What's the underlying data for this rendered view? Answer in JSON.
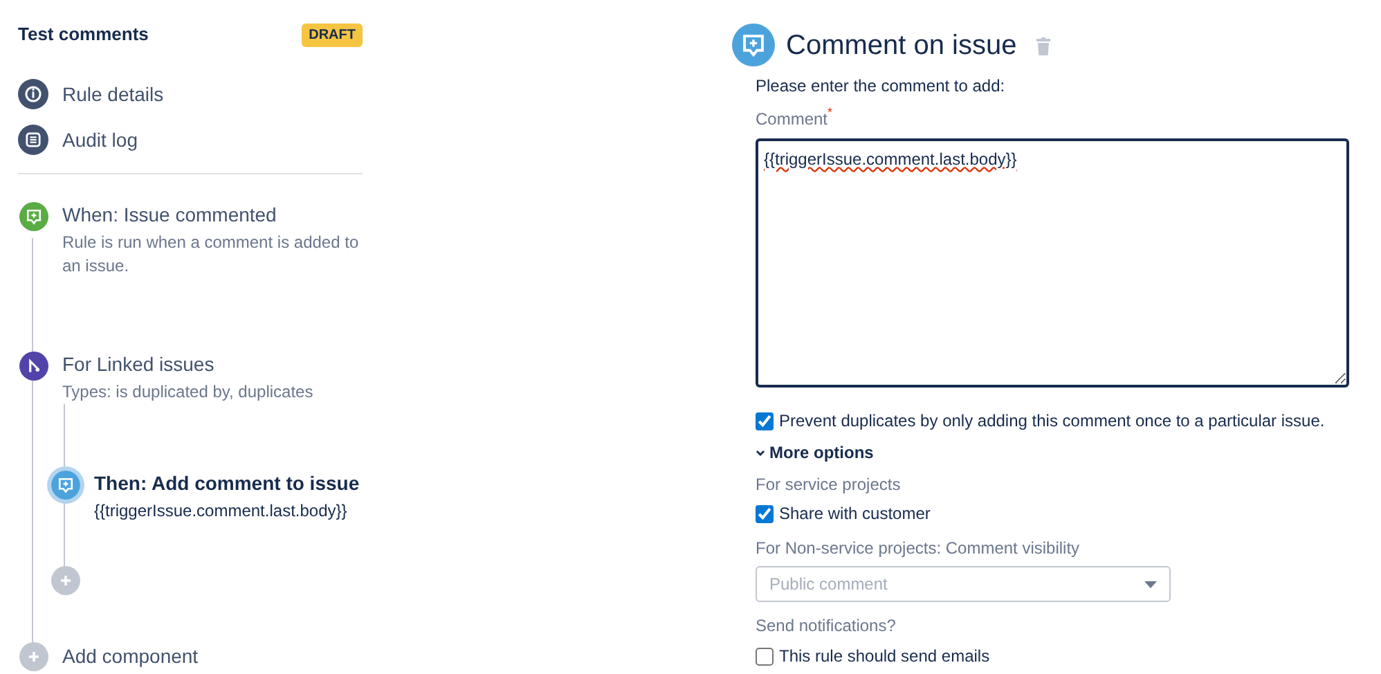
{
  "rule": {
    "title": "Test comments",
    "badge": "DRAFT"
  },
  "nav": [
    {
      "kind": "info",
      "label": "Rule details"
    },
    {
      "kind": "log",
      "label": "Audit log"
    }
  ],
  "components": [
    {
      "kind": "trigger",
      "title": "When: Issue commented",
      "description": "Rule is run when a comment is added to an issue.",
      "selected": false
    },
    {
      "kind": "branch",
      "title": "For Linked issues",
      "description": "Types: is duplicated by, duplicates",
      "selected": false,
      "children": [
        {
          "kind": "action",
          "title": "Then: Add comment to issue",
          "description": "{{triggerIssue.comment.last.body}}",
          "selected": true
        }
      ]
    }
  ],
  "add_component": {
    "label": "Add component"
  },
  "editor": {
    "title": "Comment on issue",
    "intro": "Please enter the comment to add:",
    "comment_label": "Comment",
    "required_mark": "*",
    "comment_value": "{{triggerIssue.comment.last.body}}",
    "prevent_duplicates": {
      "label": "Prevent duplicates by only adding this comment once to a particular issue.",
      "checked": true
    },
    "more_options": {
      "label": "More options",
      "expanded": true
    },
    "service_heading": "For service projects",
    "share_with_customer": {
      "label": "Share with customer",
      "checked": true
    },
    "visibility_label": "For Non-service projects: Comment visibility",
    "visibility_placeholder": "Public comment",
    "notifications_label": "Send notifications?",
    "send_emails": {
      "label": "This rule should send emails",
      "checked": false
    }
  }
}
